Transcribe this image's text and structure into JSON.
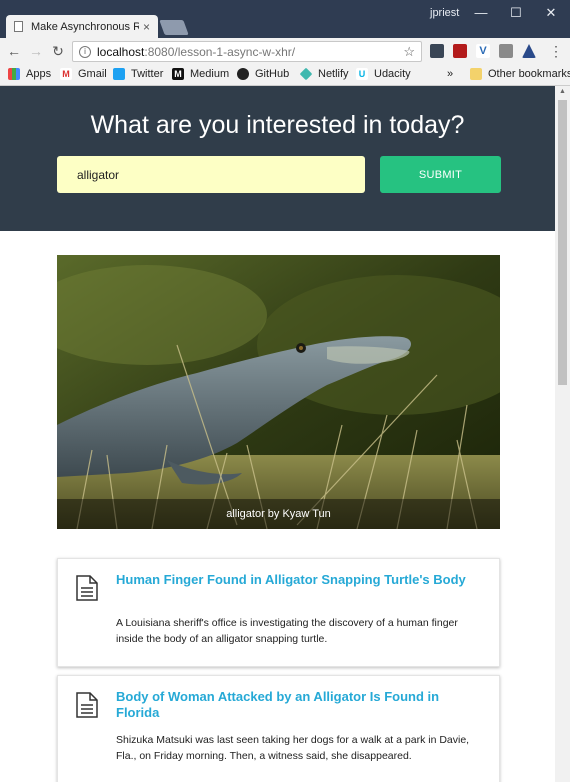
{
  "browser": {
    "tab_title": "Make Asynchronous Req",
    "tab_close": "×",
    "profile": "jpriest",
    "url_host": "localhost",
    "url_path": ":8080/lesson-1-async-w-xhr/",
    "bookmarks": [
      {
        "label": "Apps"
      },
      {
        "label": "Gmail"
      },
      {
        "label": "Twitter"
      },
      {
        "label": "Medium"
      },
      {
        "label": "GitHub"
      },
      {
        "label": "Netlify"
      },
      {
        "label": "Udacity"
      }
    ],
    "bookmarks_overflow": "»",
    "other_bookmarks": "Other bookmarks",
    "colors": {
      "titlebar": "#2f3c52",
      "chrome": "#f2f2f2"
    }
  },
  "page": {
    "heading": "What are you interested in today?",
    "search": {
      "value": "alligator"
    },
    "submit_label": "SUBMIT",
    "image_caption": "alligator by Kyaw Tun",
    "articles": [
      {
        "title": "Human Finger Found in Alligator Snapping Turtle's Body",
        "snippet": "A Louisiana sheriff's office is investigating the discovery of a human finger inside the body of an alligator snapping turtle."
      },
      {
        "title": "Body of Woman Attacked by an Alligator Is Found in Florida",
        "snippet": "Shizuka Matsuki was last seen taking her dogs for a walk at a park in Davie, Fla., on Friday morning. Then, a witness said, she disappeared."
      }
    ],
    "colors": {
      "hero": "#303d4a",
      "search_bg": "#fdffc5",
      "submit": "#26c281",
      "link": "#26a9d6"
    }
  }
}
